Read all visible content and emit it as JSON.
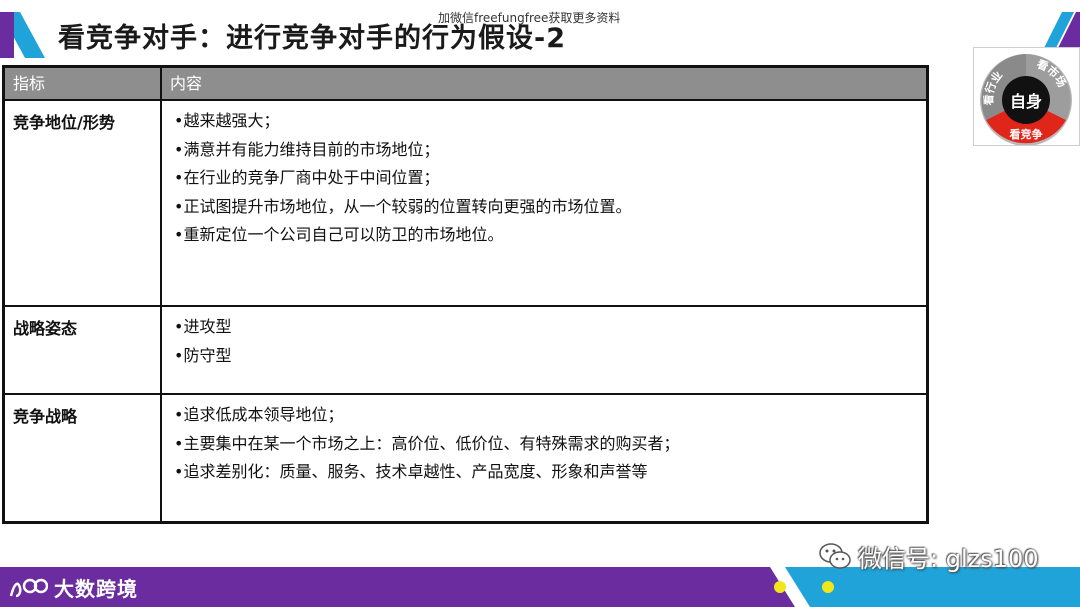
{
  "slide": {
    "title": "看竞争对手：进行竞争对手的行为假设-2",
    "top_watermark": "加微信freefungfree获取更多资料"
  },
  "table": {
    "headers": [
      "指标",
      "内容"
    ],
    "rows": [
      {
        "key": "竞争地位/形势",
        "items": [
          "•越来越强大；",
          "•满意并有能力维持目前的市场地位；",
          "•在行业的竞争厂商中处于中间位置；",
          "•正试图提升市场地位，从一个较弱的位置转向更强的市场位置。",
          "•重新定位一个公司自己可以防卫的市场地位。"
        ]
      },
      {
        "key": "战略姿态",
        "items": [
          "•进攻型",
          "•防守型"
        ]
      },
      {
        "key": "竞争战略",
        "items": [
          "•追求低成本领导地位；",
          "•主要集中在某一个市场之上：高价位、低价位、有特殊需求的购买者；",
          "•追求差别化：质量、服务、技术卓越性、产品宽度、形象和声誉等"
        ]
      }
    ]
  },
  "wheel_logo": {
    "center": "自身",
    "segments": [
      "看行业",
      "看市场",
      "看竞争"
    ]
  },
  "footer": {
    "brand": "大数跨境",
    "wechat": "微信号: glzs100"
  },
  "colors": {
    "header_gray": "#8e8e8e",
    "accent_purple": "#6a2c9e",
    "accent_blue": "#1fa3d8",
    "accent_red": "#e0251b",
    "accent_yellow": "#f2e51b",
    "wheel_gray": "#8a8a8a"
  }
}
